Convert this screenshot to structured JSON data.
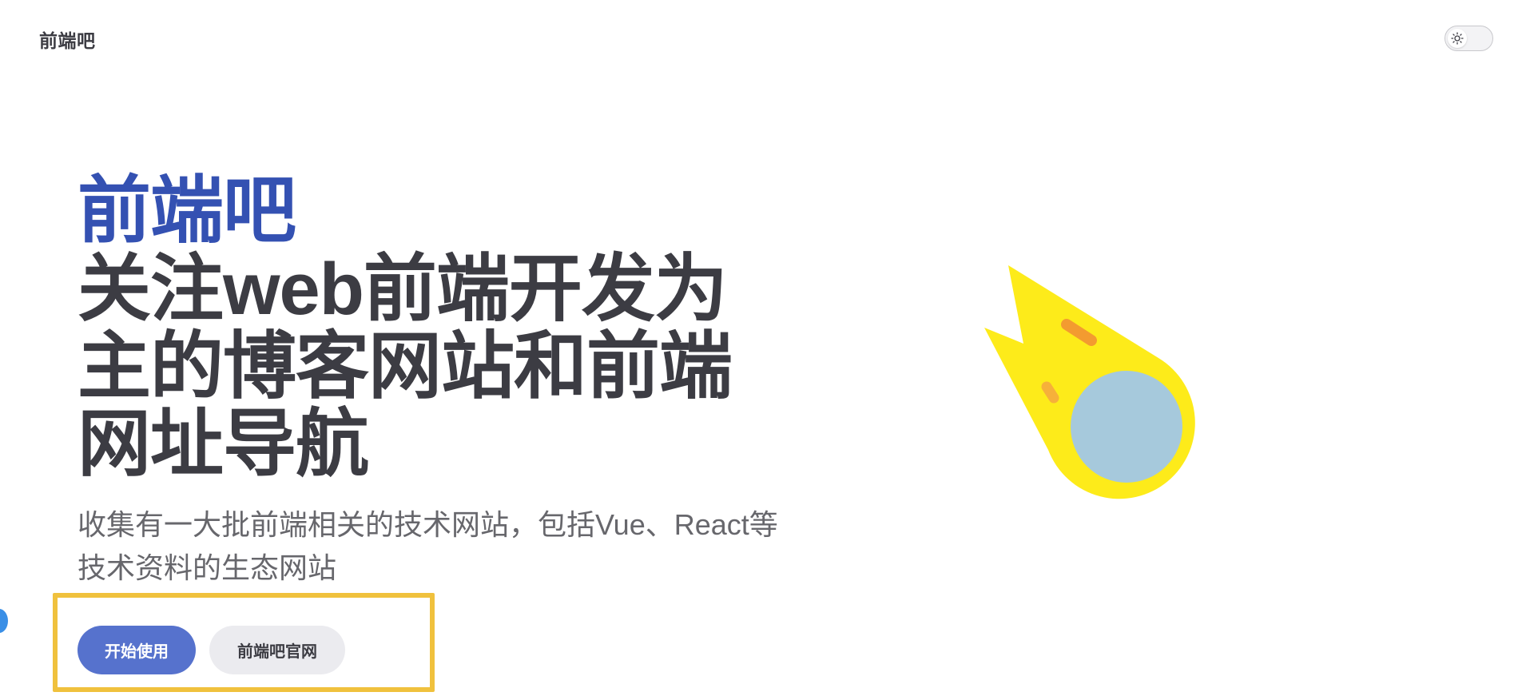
{
  "nav": {
    "title": "前端吧",
    "theme_toggle_icon": "sun-icon"
  },
  "hero": {
    "name": "前端吧",
    "text": "关注web前端开发为主的博客网站和前端网址导航",
    "tagline": "收集有一大批前端相关的技术网站，包括Vue、React等技术资料的生态网站",
    "image_icon": "comet-icon",
    "actions": [
      {
        "label": "开始使用"
      },
      {
        "label": "前端吧官网"
      }
    ]
  },
  "colors": {
    "brand": "#3451b2",
    "button_brand": "#5672cd",
    "button_alt": "#ebebef",
    "highlight_border": "#f0c13d",
    "comet_yellow": "#fdeb1a",
    "comet_core": "#a6c9dc",
    "comet_streak": "#f39b30"
  }
}
